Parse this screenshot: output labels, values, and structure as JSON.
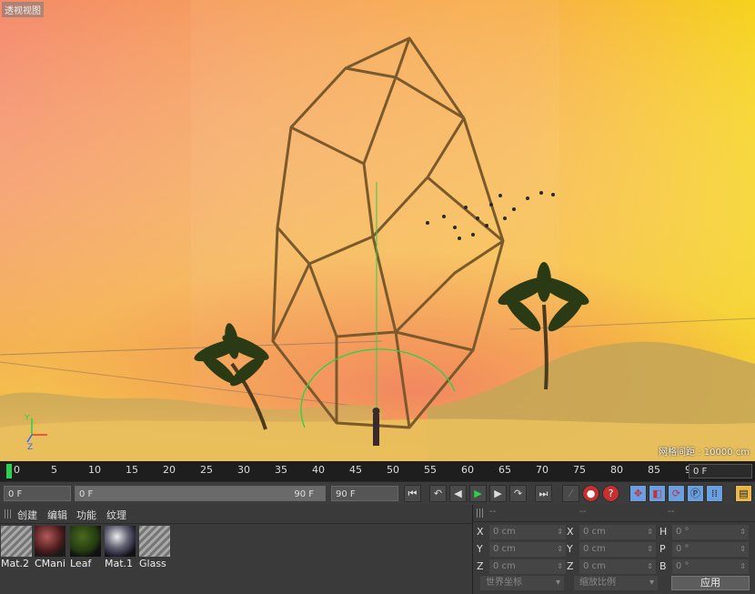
{
  "viewport": {
    "title": "透视视图",
    "grid_label": "网格间距 : 10000 cm"
  },
  "timeline": {
    "ticks": [
      "0",
      "5",
      "10",
      "15",
      "20",
      "25",
      "30",
      "35",
      "40",
      "45",
      "50",
      "55",
      "60",
      "65",
      "70",
      "75",
      "80",
      "85",
      "90"
    ],
    "current_frame": "0 F"
  },
  "transport": {
    "start_field": "0 F",
    "range_start": "0 F",
    "range_end": "90 F",
    "end_field": "90 F",
    "buttons": [
      "go-start",
      "prev-key",
      "prev-frame",
      "play",
      "next-frame",
      "next-key",
      "go-end"
    ]
  },
  "material_manager": {
    "menu": [
      "创建",
      "编辑",
      "功能",
      "纹理"
    ],
    "materials": [
      {
        "name": "Mat.2",
        "kind": "striped"
      },
      {
        "name": "CMani",
        "kind": "sphere-red"
      },
      {
        "name": "Leaf",
        "kind": "sphere-green"
      },
      {
        "name": "Mat.1",
        "kind": "sphere-chrome"
      },
      {
        "name": "Glass",
        "kind": "striped"
      }
    ]
  },
  "attributes": {
    "headers": [
      "--",
      "--",
      "--"
    ],
    "col1": [
      {
        "label": "X",
        "value": "0 cm"
      },
      {
        "label": "Y",
        "value": "0 cm"
      },
      {
        "label": "Z",
        "value": "0 cm"
      }
    ],
    "col2": [
      {
        "label": "X",
        "value": "0 cm"
      },
      {
        "label": "Y",
        "value": "0 cm"
      },
      {
        "label": "Z",
        "value": "0 cm"
      }
    ],
    "col3": [
      {
        "label": "H",
        "value": "0 °"
      },
      {
        "label": "P",
        "value": "0 °"
      },
      {
        "label": "B",
        "value": "0 °"
      }
    ],
    "coord_mode": "世界坐标",
    "scale_mode": "缩放比例",
    "apply_label": "应用"
  },
  "colors": {
    "accent_green": "#2ad14b",
    "panel_bg": "#3a3a3a"
  }
}
